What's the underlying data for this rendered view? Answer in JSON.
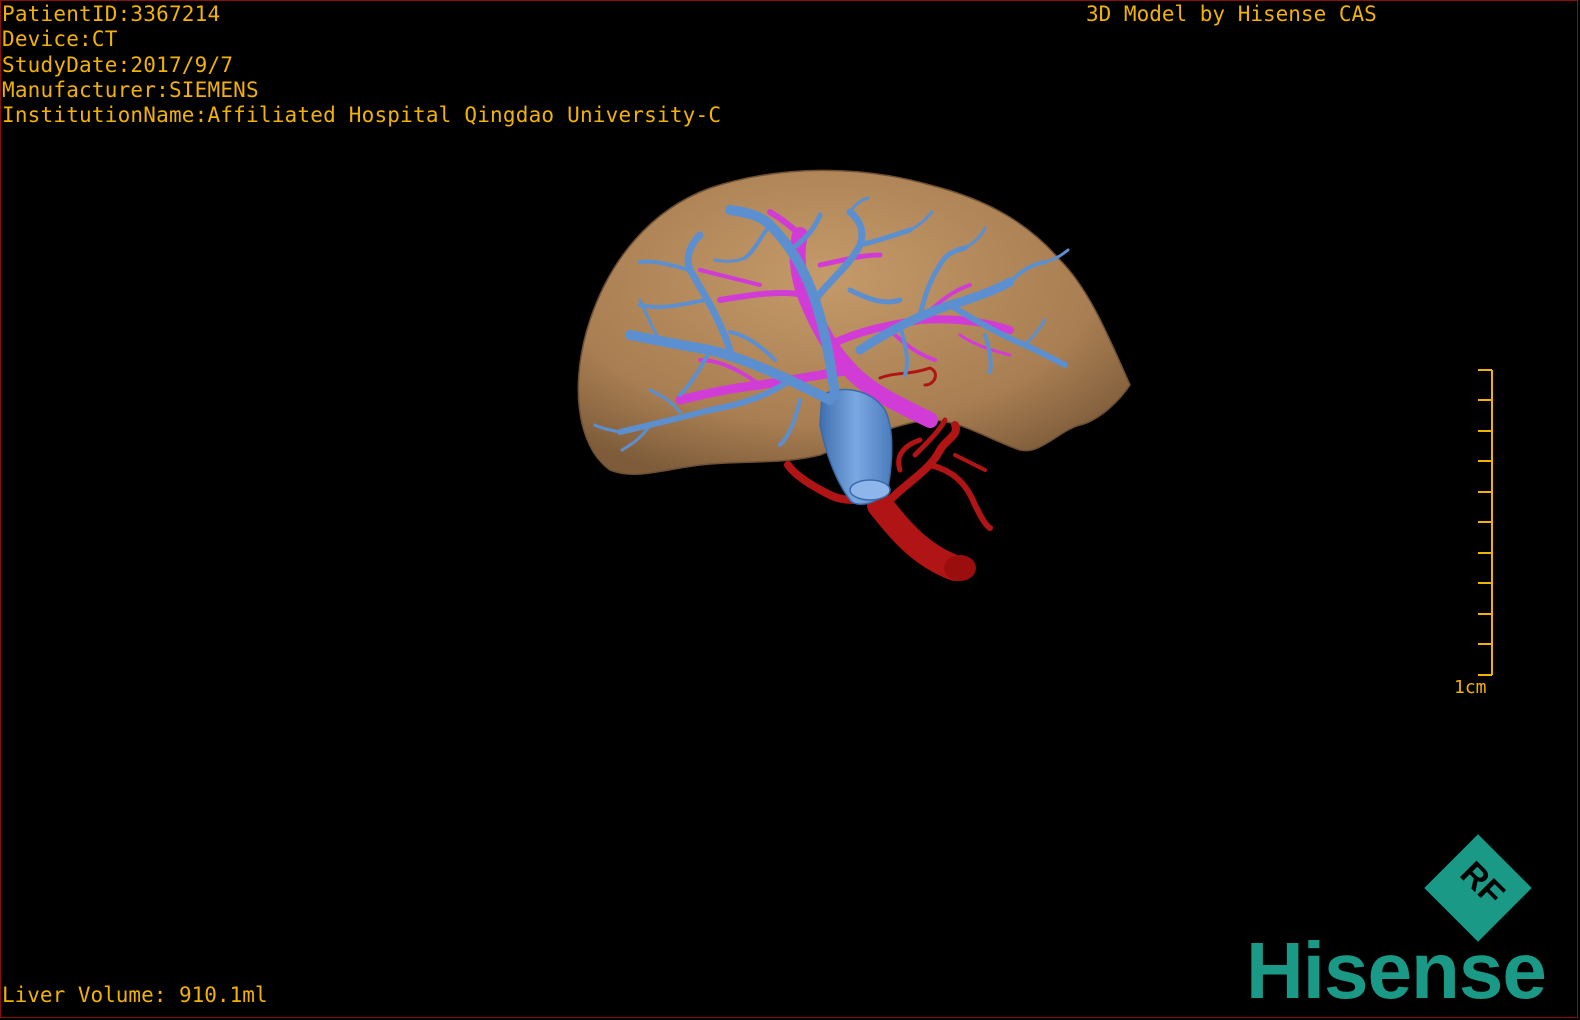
{
  "overlay": {
    "patient_id": "PatientID:3367214",
    "device": "Device:CT",
    "study_date": "StudyDate:2017/9/7",
    "manufacturer": "Manufacturer:SIEMENS",
    "institution": "InstitutionName:Affiliated Hospital Qingdao University-C"
  },
  "header": {
    "model_title": "3D Model by Hisense CAS"
  },
  "footer": {
    "liver_volume": "Liver Volume: 910.1ml"
  },
  "scale_bar": {
    "label": "1cm"
  },
  "logo": {
    "brand": "Hisense",
    "badge": "RF"
  },
  "colors": {
    "overlay_text": "#f2b200",
    "liver": "#b48a5e",
    "hepatic_vein": "#5b8fd0",
    "portal_vein": "#d23cd6",
    "artery": "#b01414",
    "brand": "#1a9a86"
  }
}
